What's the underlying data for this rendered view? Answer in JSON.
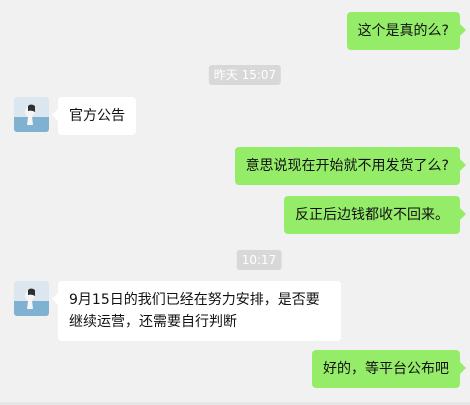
{
  "messages": [
    {
      "side": "me",
      "text": "这个是真的么?"
    },
    {
      "time": "昨天 15:07"
    },
    {
      "side": "other",
      "text": "官方公告"
    },
    {
      "side": "me",
      "text": "意思说现在开始就不用发货了么?"
    },
    {
      "side": "me",
      "text": "反正后边钱都收不回来。"
    },
    {
      "time": "10:17"
    },
    {
      "side": "other",
      "text": "9月15日的我们已经在努力安排，是否要继续运营，还需要自行判断"
    },
    {
      "side": "me",
      "text": "好的，等平台公布吧"
    }
  ],
  "avatar": {
    "icon": "contact-avatar-icon"
  }
}
